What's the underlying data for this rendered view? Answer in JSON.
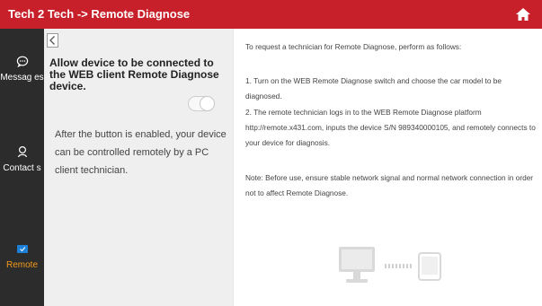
{
  "header": {
    "title": "Tech 2 Tech -> Remote Diagnose",
    "home_icon": "home-icon",
    "bg_color": "#c8202a"
  },
  "sidebar": {
    "items": [
      {
        "label": "Messag es",
        "icon": "chat-bubble-icon"
      },
      {
        "label": "Contact s",
        "icon": "contact-person-icon"
      },
      {
        "label": "Remote",
        "icon": "remote-icon",
        "active": true
      }
    ],
    "active_color": "#f39a1b"
  },
  "left": {
    "back_icon": "back-chevron-icon",
    "heading": "Allow device to be connected to the WEB client Remote Diagnose device.",
    "toggle_state": "off",
    "description": "After the button is enabled, your device can be controlled remotely by a PC client technician."
  },
  "right": {
    "intro": "To request a technician for Remote Diagnose, perform as follows:",
    "steps": [
      "1. Turn on the WEB Remote Diagnose switch and choose the car model to be diagnosed.",
      "2. The remote technician logs in to the WEB Remote Diagnose platform http://remote.x431.com, inputs the device S/N 989340000105, and remotely connects to your device for diagnosis."
    ],
    "note": "Note: Before use, ensure stable network signal and normal network connection in order not to affect Remote Diagnose.",
    "illustration_icons": [
      "computer-icon",
      "tablet-icon"
    ]
  }
}
